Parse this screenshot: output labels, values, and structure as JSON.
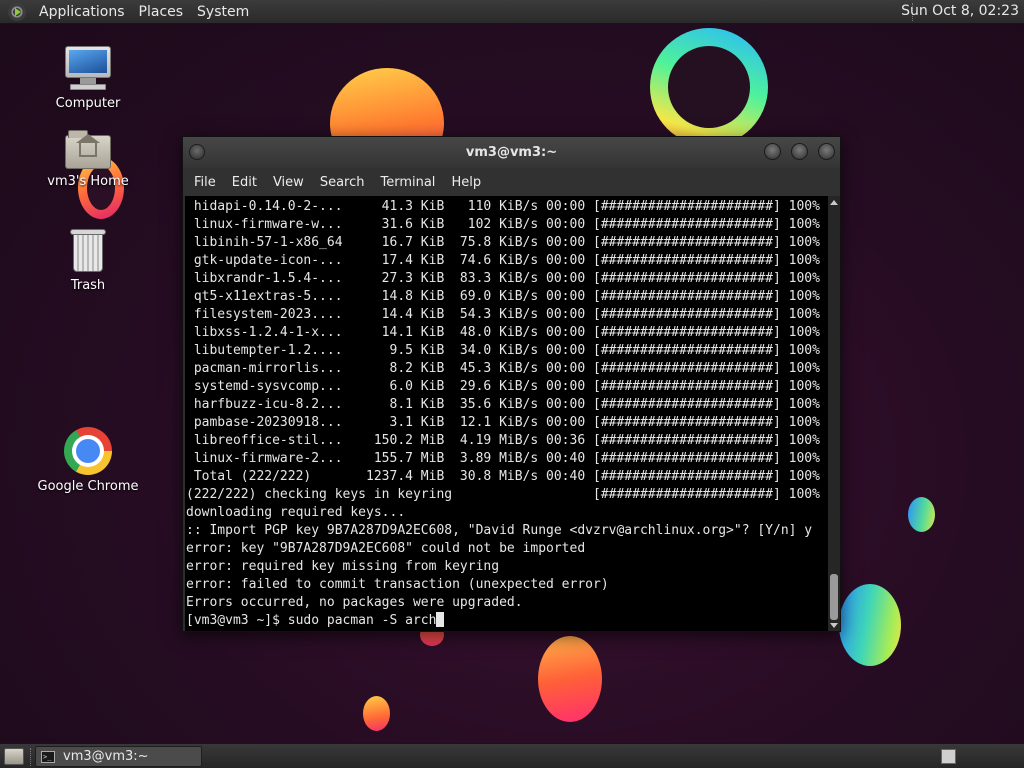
{
  "top_panel": {
    "menus": [
      "Applications",
      "Places",
      "System"
    ],
    "clock": "Sun Oct  8, 02:23"
  },
  "desktop_icons": [
    {
      "label": "Computer",
      "icon": "computer-icon"
    },
    {
      "label": "vm3's Home",
      "icon": "home-folder-icon"
    },
    {
      "label": "Trash",
      "icon": "trash-icon"
    },
    {
      "label": "Google Chrome",
      "icon": "chrome-icon"
    }
  ],
  "terminal": {
    "title": "vm3@vm3:~",
    "menu": [
      "File",
      "Edit",
      "View",
      "Search",
      "Terminal",
      "Help"
    ],
    "lines": [
      " hidapi-0.14.0-2-...     41.3 KiB   110 KiB/s 00:00 [######################] 100%",
      " linux-firmware-w...     31.6 KiB   102 KiB/s 00:00 [######################] 100%",
      " libinih-57-1-x86_64     16.7 KiB  75.8 KiB/s 00:00 [######################] 100%",
      " gtk-update-icon-...     17.4 KiB  74.6 KiB/s 00:00 [######################] 100%",
      " libxrandr-1.5.4-...     27.3 KiB  83.3 KiB/s 00:00 [######################] 100%",
      " qt5-x11extras-5....     14.8 KiB  69.0 KiB/s 00:00 [######################] 100%",
      " filesystem-2023....     14.4 KiB  54.3 KiB/s 00:00 [######################] 100%",
      " libxss-1.2.4-1-x...     14.1 KiB  48.0 KiB/s 00:00 [######################] 100%",
      " libutempter-1.2....      9.5 KiB  34.0 KiB/s 00:00 [######################] 100%",
      " pacman-mirrorlis...      8.2 KiB  45.3 KiB/s 00:00 [######################] 100%",
      " systemd-sysvcomp...      6.0 KiB  29.6 KiB/s 00:00 [######################] 100%",
      " harfbuzz-icu-8.2...      8.1 KiB  35.6 KiB/s 00:00 [######################] 100%",
      " pambase-20230918...      3.1 KiB  12.1 KiB/s 00:00 [######################] 100%",
      " libreoffice-stil...    150.2 MiB  4.19 MiB/s 00:36 [######################] 100%",
      " linux-firmware-2...    155.7 MiB  3.89 MiB/s 00:40 [######################] 100%",
      " Total (222/222)       1237.4 MiB  30.8 MiB/s 00:40 [######################] 100%",
      "(222/222) checking keys in keyring                  [######################] 100%",
      "downloading required keys...",
      ":: Import PGP key 9B7A287D9A2EC608, \"David Runge <dvzrv@archlinux.org>\"? [Y/n] y",
      "error: key \"9B7A287D9A2EC608\" could not be imported",
      "error: required key missing from keyring",
      "error: failed to commit transaction (unexpected error)",
      "Errors occurred, no packages were upgraded."
    ],
    "prompt": "[vm3@vm3 ~]$ sudo pacman -S arch"
  },
  "taskbar": {
    "task_label": "vm3@vm3:~",
    "task_icon_text": ">_"
  }
}
